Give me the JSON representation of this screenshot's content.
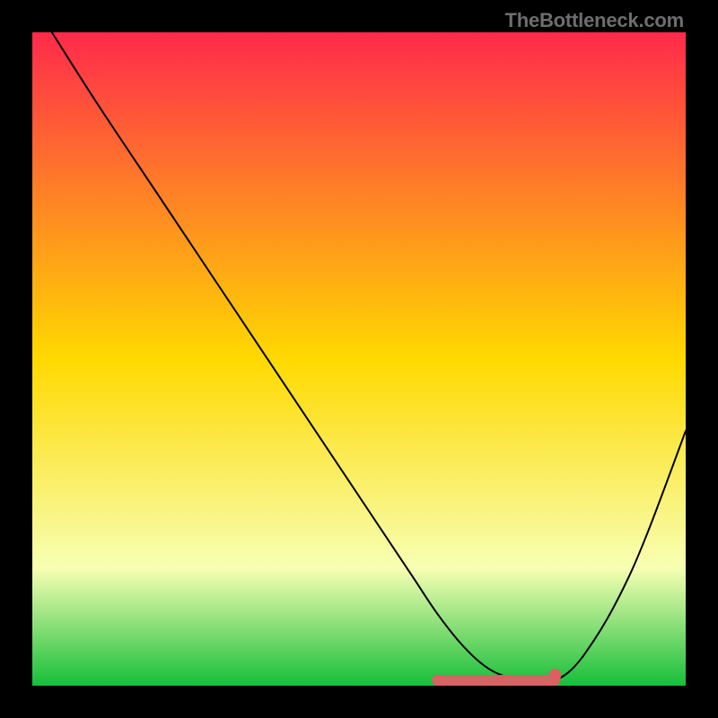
{
  "watermark": "TheBottleneck.com",
  "colors": {
    "frame": "#000000",
    "gradient_top": "#ff2a4b",
    "gradient_yellow": "#ffd900",
    "gradient_pale": "#f7ffb3",
    "gradient_green": "#17be3a",
    "curve": "#000000",
    "marker_fill": "#d86262",
    "marker_stroke": "#b84848"
  },
  "chart_data": {
    "type": "line",
    "title": "",
    "xlabel": "",
    "ylabel": "",
    "xlim": [
      0,
      100
    ],
    "ylim": [
      0,
      100
    ],
    "x": [
      3,
      10,
      20,
      30,
      40,
      50,
      58,
      62,
      66,
      70,
      74,
      78,
      82,
      86,
      90,
      94,
      100
    ],
    "values": [
      100,
      89,
      74,
      59,
      44,
      29,
      17,
      11,
      6,
      2.5,
      1,
      0.5,
      2,
      7,
      14,
      23,
      39
    ],
    "marker_segment": {
      "x_start": 62,
      "x_end": 80,
      "y": 0
    },
    "marker_point": {
      "x": 80,
      "y": 0.8
    }
  }
}
